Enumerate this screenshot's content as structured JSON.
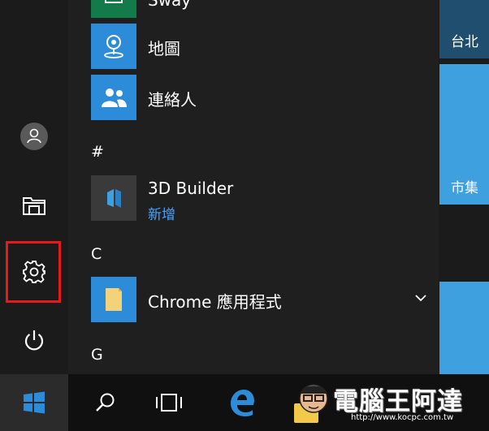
{
  "apps": {
    "partial_top": "Sway",
    "maps": "地圖",
    "contacts": "連絡人",
    "section_hash": "#",
    "builder_name": "3D Builder",
    "builder_badge": "新增",
    "section_c": "C",
    "chrome_apps": "Chrome 應用程式",
    "section_g": "G"
  },
  "tiles": {
    "weather_city": "台北",
    "tile2_label": "市集"
  },
  "watermark": {
    "title": "電腦王阿達",
    "url": "http://www.kocpc.com.tw"
  },
  "colors": {
    "accent": "#2d8cd9",
    "tile_blue": "#3fa0e0",
    "highlight": "#e8191c"
  },
  "icons": {
    "user": "user-avatar-icon",
    "documents": "file-explorer-icon",
    "settings": "gear-icon",
    "power": "power-icon",
    "start": "windows-logo-icon",
    "search": "search-icon",
    "task_view": "task-view-icon",
    "edge": "edge-icon"
  }
}
